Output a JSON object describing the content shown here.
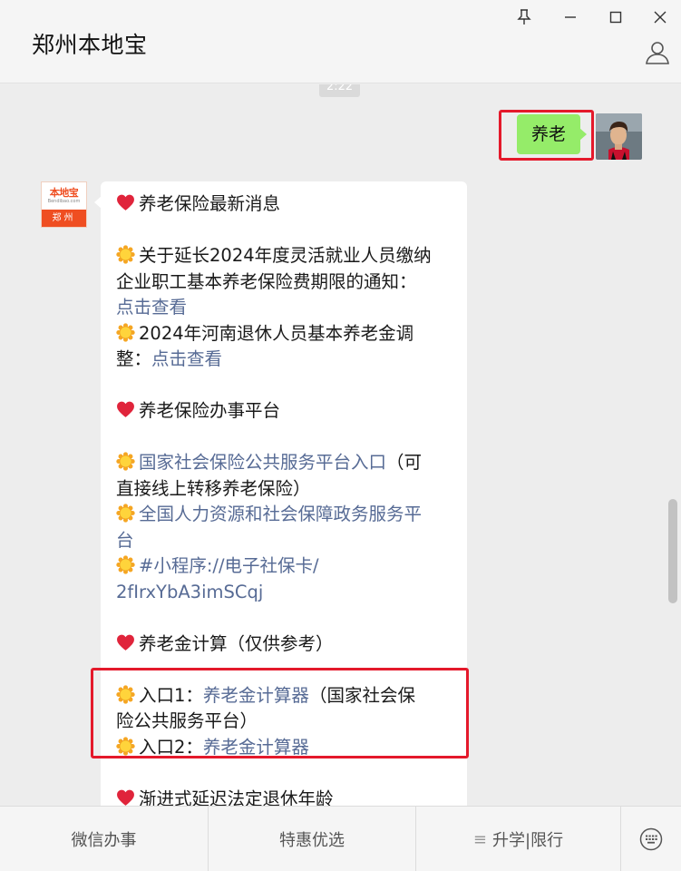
{
  "window": {
    "title": "郑州本地宝"
  },
  "chat": {
    "timestamp": "2:22",
    "my_message": "养老",
    "bot_avatar": {
      "logo_text": "本地宝",
      "logo_sub": "Bendibao.com",
      "city": "郑州"
    },
    "bot_lines": [
      {
        "parts": [
          {
            "t": "emoji",
            "v": "heart"
          },
          {
            "t": "text",
            "v": "养老保险最新消息"
          }
        ]
      },
      {
        "blank": true
      },
      {
        "parts": [
          {
            "t": "emoji",
            "v": "sun"
          },
          {
            "t": "text",
            "v": "关于延长2024年度灵活就业人员缴纳"
          }
        ]
      },
      {
        "parts": [
          {
            "t": "text",
            "v": "企业职工基本养老保险费期限的通知："
          }
        ]
      },
      {
        "parts": [
          {
            "t": "link",
            "v": "点击查看"
          }
        ]
      },
      {
        "parts": [
          {
            "t": "emoji",
            "v": "sun"
          },
          {
            "t": "text",
            "v": "2024年河南退休人员基本养老金调"
          }
        ]
      },
      {
        "parts": [
          {
            "t": "text",
            "v": "整："
          },
          {
            "t": "link",
            "v": "点击查看"
          }
        ]
      },
      {
        "blank": true
      },
      {
        "parts": [
          {
            "t": "emoji",
            "v": "heart"
          },
          {
            "t": "text",
            "v": "养老保险办事平台"
          }
        ]
      },
      {
        "blank": true
      },
      {
        "parts": [
          {
            "t": "emoji",
            "v": "sun"
          },
          {
            "t": "link",
            "v": "国家社会保险公共服务平台入口"
          },
          {
            "t": "text",
            "v": "（可"
          }
        ]
      },
      {
        "parts": [
          {
            "t": "text",
            "v": "直接线上转移养老保险）"
          }
        ]
      },
      {
        "parts": [
          {
            "t": "emoji",
            "v": "sun"
          },
          {
            "t": "link",
            "v": "全国人力资源和社会保障政务服务平"
          }
        ]
      },
      {
        "parts": [
          {
            "t": "link",
            "v": "台"
          }
        ]
      },
      {
        "parts": [
          {
            "t": "emoji",
            "v": "sun"
          },
          {
            "t": "link",
            "v": "#小程序://电子社保卡/"
          }
        ]
      },
      {
        "parts": [
          {
            "t": "link",
            "v": "2fIrxYbA3imSCqj"
          }
        ]
      },
      {
        "blank": true
      },
      {
        "parts": [
          {
            "t": "emoji",
            "v": "heart"
          },
          {
            "t": "text",
            "v": "养老金计算（仅供参考）"
          }
        ]
      },
      {
        "blank": true
      },
      {
        "parts": [
          {
            "t": "emoji",
            "v": "sun"
          },
          {
            "t": "text",
            "v": "入口1："
          },
          {
            "t": "link",
            "v": "养老金计算器"
          },
          {
            "t": "text",
            "v": "（国家社会保"
          }
        ]
      },
      {
        "parts": [
          {
            "t": "text",
            "v": "险公共服务平台）"
          }
        ]
      },
      {
        "parts": [
          {
            "t": "emoji",
            "v": "sun"
          },
          {
            "t": "text",
            "v": "入口2："
          },
          {
            "t": "link",
            "v": "养老金计算器"
          }
        ]
      },
      {
        "blank": true
      },
      {
        "parts": [
          {
            "t": "emoji",
            "v": "heart"
          },
          {
            "t": "text",
            "v": "渐进式延迟法定退休年龄"
          }
        ]
      }
    ]
  },
  "menu": {
    "items": [
      {
        "label": "微信办事",
        "prefix": ""
      },
      {
        "label": "特惠优选",
        "prefix": ""
      },
      {
        "label": "升学|限行",
        "prefix": "≡"
      }
    ]
  },
  "colors": {
    "my_bubble": "#95ec69",
    "highlight": "#e4192b",
    "link": "#576b95"
  }
}
